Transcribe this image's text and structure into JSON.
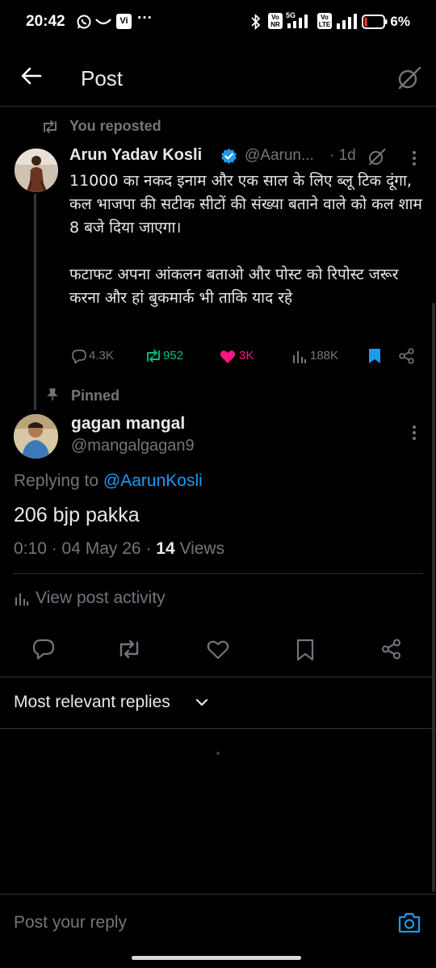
{
  "status_bar": {
    "time": "20:42",
    "battery": "6%"
  },
  "header": {
    "title": "Post"
  },
  "repost": {
    "label": "You reposted"
  },
  "original_post": {
    "author_name": "Arun Yadav Kosli",
    "handle": "@Aarun...",
    "time": "· 1d",
    "text": "11000 का नकद इनाम और एक साल के लिए ब्लू टिक दूंगा,\nकल भाजपा की सटीक सीटों की संख्या बताने वाले को कल शाम 8 बजे दिया जाएगा।\n\nफटाफट अपना आंकलन बताओ और पोस्ट को रिपोस्ट जरूर करना और हां बुकमार्क भी ताकि याद रहे",
    "stats": {
      "replies": "4.3K",
      "reposts": "952",
      "likes": "3K",
      "views": "188K"
    }
  },
  "reply_post": {
    "pinned_label": "Pinned",
    "author_name": "gagan mangal",
    "handle": "@mangalgagan9",
    "replying_prefix": "Replying to ",
    "replying_to": "@AarunKosli",
    "text": "206 bjp pakka",
    "time_date": "0:10 · 04 May 26 · ",
    "views_count": "14",
    "views_label": " Views"
  },
  "activity": {
    "label": "View post activity"
  },
  "sort": {
    "label": "Most relevant replies"
  },
  "reply_bar": {
    "placeholder": "Post your reply"
  },
  "colors": {
    "accent": "#1d9bf0",
    "repost_green": "#00ba7c",
    "like_pink": "#f91880",
    "muted": "#71767b"
  }
}
